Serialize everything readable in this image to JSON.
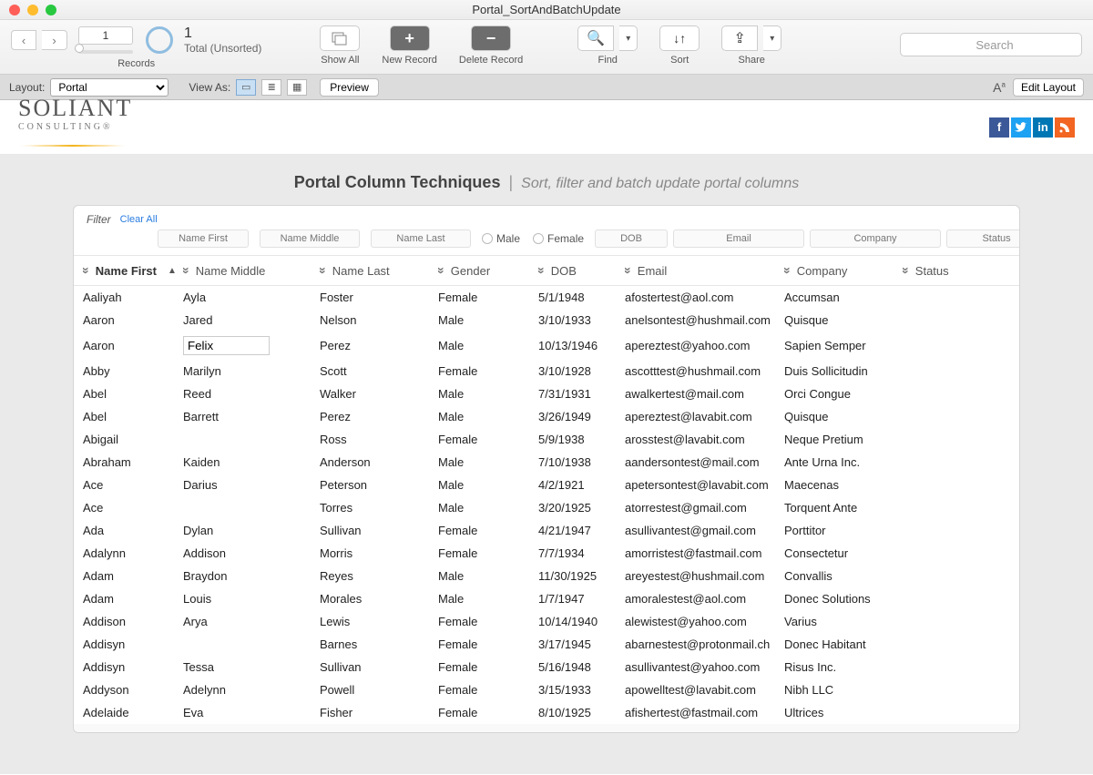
{
  "window": {
    "title": "Portal_SortAndBatchUpdate"
  },
  "toolbar": {
    "record_number": "1",
    "total_count": "1",
    "total_label": "Total (Unsorted)",
    "records_label": "Records",
    "show_all": "Show All",
    "new_record": "New Record",
    "delete_record": "Delete Record",
    "find": "Find",
    "sort": "Sort",
    "share": "Share",
    "search_placeholder": "Search"
  },
  "layoutbar": {
    "layout_label": "Layout:",
    "layout_value": "Portal",
    "view_as": "View As:",
    "preview": "Preview",
    "edit_layout": "Edit Layout"
  },
  "logo": {
    "name": "SOLIANT",
    "tag": "CONSULTING®"
  },
  "heading": {
    "title": "Portal Column Techniques",
    "subtitle": "Sort, filter and batch update portal columns"
  },
  "filter": {
    "label": "Filter",
    "clear_all": "Clear All",
    "placeholders": {
      "first": "Name First",
      "middle": "Name Middle",
      "last": "Name Last",
      "male": "Male",
      "female": "Female",
      "dob": "DOB",
      "email": "Email",
      "company": "Company",
      "status": "Status"
    }
  },
  "columns": {
    "first": "Name First",
    "middle": "Name Middle",
    "last": "Name Last",
    "gender": "Gender",
    "dob": "DOB",
    "email": "Email",
    "company": "Company",
    "status": "Status"
  },
  "editing_cell": {
    "row_index": 2,
    "field": "middle",
    "value": "Felix"
  },
  "rows": [
    {
      "first": "Aaliyah",
      "middle": "Ayla",
      "last": "Foster",
      "gender": "Female",
      "dob": "5/1/1948",
      "email": "afostertest@aol.com",
      "company": "Accumsan"
    },
    {
      "first": "Aaron",
      "middle": "Jared",
      "last": "Nelson",
      "gender": "Male",
      "dob": "3/10/1933",
      "email": "anelsontest@hushmail.com",
      "company": "Quisque"
    },
    {
      "first": "Aaron",
      "middle": "Felix",
      "last": "Perez",
      "gender": "Male",
      "dob": "10/13/1946",
      "email": "apereztest@yahoo.com",
      "company": "Sapien Semper"
    },
    {
      "first": "Abby",
      "middle": "Marilyn",
      "last": "Scott",
      "gender": "Female",
      "dob": "3/10/1928",
      "email": "ascotttest@hushmail.com",
      "company": "Duis Sollicitudin"
    },
    {
      "first": "Abel",
      "middle": "Reed",
      "last": "Walker",
      "gender": "Male",
      "dob": "7/31/1931",
      "email": "awalkertest@mail.com",
      "company": "Orci Congue"
    },
    {
      "first": "Abel",
      "middle": "Barrett",
      "last": "Perez",
      "gender": "Male",
      "dob": "3/26/1949",
      "email": "apereztest@lavabit.com",
      "company": "Quisque"
    },
    {
      "first": "Abigail",
      "middle": "",
      "last": "Ross",
      "gender": "Female",
      "dob": "5/9/1938",
      "email": "arosstest@lavabit.com",
      "company": "Neque Pretium"
    },
    {
      "first": "Abraham",
      "middle": "Kaiden",
      "last": "Anderson",
      "gender": "Male",
      "dob": "7/10/1938",
      "email": "aandersontest@mail.com",
      "company": "Ante Urna Inc."
    },
    {
      "first": "Ace",
      "middle": "Darius",
      "last": "Peterson",
      "gender": "Male",
      "dob": "4/2/1921",
      "email": "apetersontest@lavabit.com",
      "company": "Maecenas"
    },
    {
      "first": "Ace",
      "middle": "",
      "last": "Torres",
      "gender": "Male",
      "dob": "3/20/1925",
      "email": "atorrestest@gmail.com",
      "company": "Torquent Ante"
    },
    {
      "first": "Ada",
      "middle": "Dylan",
      "last": "Sullivan",
      "gender": "Female",
      "dob": "4/21/1947",
      "email": "asullivantest@gmail.com",
      "company": "Porttitor"
    },
    {
      "first": "Adalynn",
      "middle": "Addison",
      "last": "Morris",
      "gender": "Female",
      "dob": "7/7/1934",
      "email": "amorristest@fastmail.com",
      "company": "Consectetur"
    },
    {
      "first": "Adam",
      "middle": "Braydon",
      "last": "Reyes",
      "gender": "Male",
      "dob": "11/30/1925",
      "email": "areyestest@hushmail.com",
      "company": "Convallis"
    },
    {
      "first": "Adam",
      "middle": "Louis",
      "last": "Morales",
      "gender": "Male",
      "dob": "1/7/1947",
      "email": "amoralestest@aol.com",
      "company": "Donec Solutions"
    },
    {
      "first": "Addison",
      "middle": "Arya",
      "last": "Lewis",
      "gender": "Female",
      "dob": "10/14/1940",
      "email": "alewistest@yahoo.com",
      "company": "Varius"
    },
    {
      "first": "Addisyn",
      "middle": "",
      "last": "Barnes",
      "gender": "Female",
      "dob": "3/17/1945",
      "email": "abarnestest@protonmail.ch",
      "company": "Donec Habitant"
    },
    {
      "first": "Addisyn",
      "middle": "Tessa",
      "last": "Sullivan",
      "gender": "Female",
      "dob": "5/16/1948",
      "email": "asullivantest@yahoo.com",
      "company": "Risus Inc."
    },
    {
      "first": "Addyson",
      "middle": "Adelynn",
      "last": "Powell",
      "gender": "Female",
      "dob": "3/15/1933",
      "email": "apowelltest@lavabit.com",
      "company": "Nibh LLC"
    },
    {
      "first": "Adelaide",
      "middle": "Eva",
      "last": "Fisher",
      "gender": "Female",
      "dob": "8/10/1925",
      "email": "afishertest@fastmail.com",
      "company": "Ultrices"
    }
  ]
}
